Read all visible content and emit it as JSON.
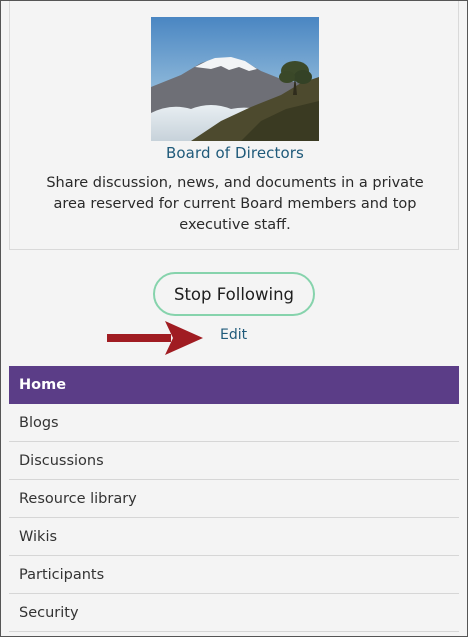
{
  "group": {
    "title": "Board of Directors",
    "description": "Share discussion, news, and documents in a private area reserved for current Board members and top executive staff."
  },
  "actions": {
    "follow_label": "Stop Following",
    "edit_label": "Edit"
  },
  "nav": {
    "items": [
      {
        "label": "Home",
        "active": true
      },
      {
        "label": "Blogs"
      },
      {
        "label": "Discussions"
      },
      {
        "label": "Resource library"
      },
      {
        "label": "Wikis"
      },
      {
        "label": "Participants"
      },
      {
        "label": "Security"
      }
    ]
  },
  "colors": {
    "accent": "#5b3d87",
    "link": "#1f5a7a",
    "button_border": "#86d3ac",
    "arrow": "#a01c22"
  },
  "icons": {
    "annotation": "red-arrow-icon"
  }
}
